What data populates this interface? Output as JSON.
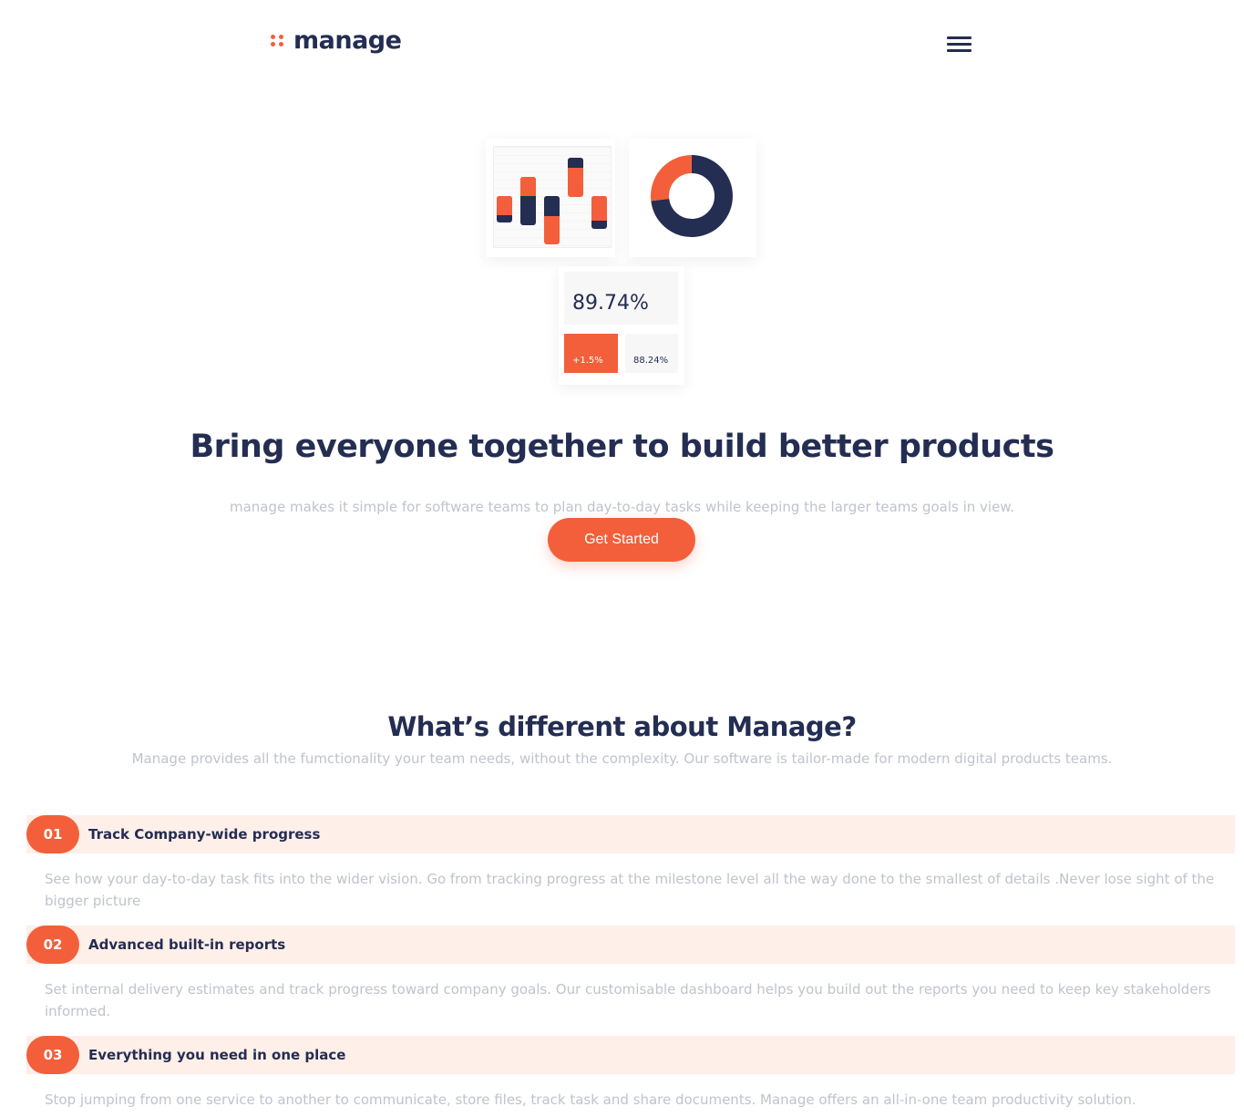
{
  "header": {
    "logo_text": "manage",
    "menu_icon": "hamburger-menu-icon"
  },
  "illustration": {
    "stat_main": "89.74%",
    "stat_change": "+1.5%",
    "stat_secondary": "88.24%",
    "bar_chart": {
      "type": "bar",
      "series_colors": [
        "#242d52",
        "#f25f3a"
      ]
    },
    "donut_chart": {
      "type": "pie",
      "slices": [
        {
          "color": "#242d52",
          "fraction": 0.73
        },
        {
          "color": "#f25f3a",
          "fraction": 0.27
        }
      ]
    }
  },
  "hero": {
    "title": "Bring everyone together to build better products",
    "description": "manage makes it simple for software teams to plan day-to-day tasks while keeping the larger teams goals in view.",
    "cta_label": "Get Started"
  },
  "features": {
    "title": "What’s different about Manage?",
    "description": "Manage provides all the fumctionality your team needs, without the complexity. Our software is tailor-made for modern digital products teams.",
    "items": [
      {
        "number": "01",
        "title": "Track Company-wide progress",
        "text": "See how your day-to-day task fits into the wider vision. Go from tracking progress at the milestone level all the way done to the smallest of details .Never lose sight of the bigger picture"
      },
      {
        "number": "02",
        "title": "Advanced built-in reports",
        "text": "Set internal delivery estimates and track progress toward company goals. Our customisable dashboard helps you build out the reports you need to keep key stakeholders informed."
      },
      {
        "number": "03",
        "title": "Everything you need in one place",
        "text": "Stop jumping from one service to another to communicate, store files, track task and share documents. Manage offers an all-in-one team productivity solution."
      }
    ]
  },
  "colors": {
    "accent": "#f25f3a",
    "navy": "#242d52",
    "muted_text": "#c0c3cc",
    "feature_bg": "#ffefe9"
  }
}
